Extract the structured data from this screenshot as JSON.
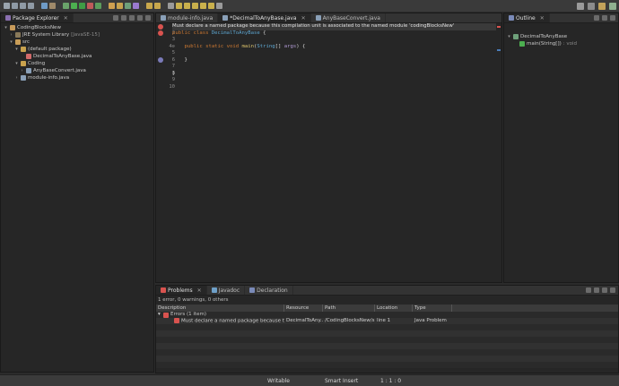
{
  "toolbar": {
    "buttons": [
      {
        "icon": "new-file-icon",
        "color": "#9aa4ad"
      },
      {
        "icon": "save-icon",
        "color": "#8f9aa5"
      },
      {
        "icon": "save-all-icon",
        "color": "#8f9aa5"
      },
      {
        "icon": "print-icon",
        "color": "#8f9aa5"
      },
      {
        "icon": "build-icon",
        "color": "#6e9bc7"
      },
      {
        "icon": "new-wizard-icon",
        "color": "#a08a6a"
      },
      {
        "icon": "debug-icon",
        "color": "#6aa36a"
      },
      {
        "icon": "run-icon",
        "color": "#4caf50"
      },
      {
        "icon": "run-config-icon",
        "color": "#3e9c45"
      },
      {
        "icon": "external-tools-icon",
        "color": "#c05a5a"
      },
      {
        "icon": "coverage-icon",
        "color": "#5c9c5c"
      },
      {
        "icon": "new-java-project-icon",
        "color": "#d0a050"
      },
      {
        "icon": "new-package-icon",
        "color": "#c8a24e"
      },
      {
        "icon": "new-class-icon",
        "color": "#6ea07a"
      },
      {
        "icon": "new-interface-icon",
        "color": "#9a7ad0"
      },
      {
        "icon": "open-type-icon",
        "color": "#c9a84c"
      },
      {
        "icon": "search-icon",
        "color": "#c9a84c"
      },
      {
        "icon": "toggle-mark-icon",
        "color": "#9a9a9a"
      },
      {
        "icon": "next-annotation-icon",
        "color": "#c9b04c"
      },
      {
        "icon": "prev-annotation-icon",
        "color": "#c9b04c"
      },
      {
        "icon": "last-edit-icon",
        "color": "#c9b04c"
      },
      {
        "icon": "back-icon",
        "color": "#c9b04c"
      },
      {
        "icon": "forward-icon",
        "color": "#c9b04c"
      },
      {
        "icon": "pin-editor-icon",
        "color": "#9a9a9a"
      }
    ],
    "right_buttons": [
      {
        "icon": "search-icon",
        "color": "#9a9a9a"
      },
      {
        "icon": "open-perspective-icon",
        "color": "#8c8c8c"
      },
      {
        "icon": "java-perspective-icon",
        "color": "#c2a25a"
      },
      {
        "icon": "debug-perspective-icon",
        "color": "#8fb08f"
      }
    ]
  },
  "package_explorer": {
    "tab_label": "Package Explorer",
    "tree": [
      {
        "label": "CodingBlocksNew",
        "suffix": "",
        "depth": 0,
        "twisty": "▾",
        "icon": "project-icon",
        "color": "#c79a5a"
      },
      {
        "label": "JRE System Library",
        "suffix": "[JavaSE-15]",
        "depth": 1,
        "twisty": "›",
        "icon": "library-icon",
        "color": "#8a7a5a"
      },
      {
        "label": "src",
        "suffix": "",
        "depth": 1,
        "twisty": "▾",
        "icon": "source-folder-icon",
        "color": "#c89d58"
      },
      {
        "label": "(default package)",
        "suffix": "",
        "depth": 2,
        "twisty": "▾",
        "icon": "package-icon",
        "color": "#c8a24e"
      },
      {
        "label": "DecimalToAnyBase.java",
        "suffix": "",
        "depth": 3,
        "twisty": "",
        "icon": "java-file-error-icon",
        "color": "#d16a6a"
      },
      {
        "label": "Coding",
        "suffix": "",
        "depth": 2,
        "twisty": "▾",
        "icon": "package-icon",
        "color": "#c8a24e"
      },
      {
        "label": "AnyBaseConvert.java",
        "suffix": "",
        "depth": 3,
        "twisty": "›",
        "icon": "java-file-icon",
        "color": "#8aa0b8"
      },
      {
        "label": "module-info.java",
        "suffix": "",
        "depth": 2,
        "twisty": "›",
        "icon": "java-file-icon",
        "color": "#8aa0b8"
      }
    ]
  },
  "editor": {
    "tabs": [
      {
        "label": "module-info.java",
        "active": false,
        "close": ""
      },
      {
        "label": "*DecimalToAnyBase.java",
        "active": true,
        "close": "✕"
      },
      {
        "label": "AnyBaseConvert.java",
        "active": false,
        "close": ""
      }
    ],
    "line_numbers": [
      "1",
      "2",
      "3",
      "4⊖",
      "5",
      "6",
      "7",
      "8",
      "9",
      "10"
    ],
    "error_message": "Must declare a named package because this compilation unit is associated to the named module 'codingBlocksNew'",
    "code": {
      "l2_kw1": "public",
      "l2_kw2": "class",
      "l2_name": "DecimalToAnyBase",
      "l2_rest": " {",
      "l4_kw1": "public",
      "l4_kw2": "static",
      "l4_kw3": "void",
      "l4_fn": "main",
      "l4_type": "String",
      "l4_rest": "[] ",
      "l4_param": "args",
      "l4_end": ") {",
      "l6": "}",
      "l8": "}"
    }
  },
  "outline": {
    "tab_label": "Outline",
    "items": [
      {
        "label": "DecimalToAnyBase",
        "suffix": "",
        "depth": 0,
        "twisty": "▾",
        "icon": "class-icon",
        "color": "#6ea07a"
      },
      {
        "label": "main(String[])",
        "suffix": ": void",
        "depth": 1,
        "twisty": "",
        "icon": "method-icon",
        "color": "#4caf50"
      }
    ]
  },
  "problems": {
    "tabs": [
      {
        "label": "Problems",
        "active": true,
        "icon": "problems-icon",
        "color": "#d9534f"
      },
      {
        "label": "Javadoc",
        "active": false,
        "icon": "javadoc-icon",
        "color": "#6ea0c8"
      },
      {
        "label": "Declaration",
        "active": false,
        "icon": "declaration-icon",
        "color": "#7a8ab8"
      }
    ],
    "summary": "1 error, 0 warnings, 0 others",
    "columns": [
      "Description",
      "Resource",
      "Path",
      "Location",
      "Type"
    ],
    "group": {
      "twisty": "▾",
      "label": "Errors (1 item)"
    },
    "rows": [
      [
        "Must declare a named package because this...",
        "DecimalToAny...",
        "/CodingBlocksNew/src",
        "line 1",
        "Java Problem"
      ]
    ]
  },
  "status_bar": {
    "mode": "Writable",
    "insert": "Smart Insert",
    "position": "1 : 1 : 0"
  }
}
